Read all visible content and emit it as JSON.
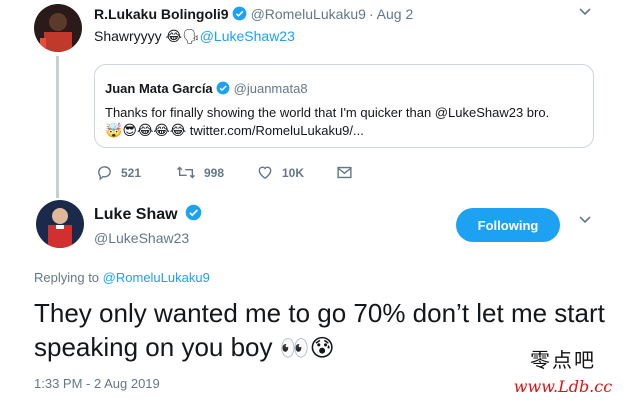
{
  "tweet1": {
    "name": "R.Lukaku Bolingoli9",
    "handle": "@RomeluLukaku9",
    "separator": "·",
    "date": "Aug 2",
    "text_start": "Shawryyyy",
    "text_emojis": "😂🗣",
    "mention": "@LukeShaw23",
    "actions": {
      "replies": "521",
      "retweets": "998",
      "likes": "10K"
    }
  },
  "quote": {
    "name": "Juan Mata García",
    "handle": "@juanmata8",
    "line1": "Thanks for finally showing the world that I'm quicker than @LukeShaw23 bro.",
    "line2_emojis": "🤯😎😂😂😂",
    "line2_link": "twitter.com/RomeluLukaku9/..."
  },
  "tweet2": {
    "name": "Luke Shaw",
    "handle": "@LukeShaw23",
    "follow_label": "Following",
    "replying_prefix": "Replying to",
    "replying_mention": "@RomeluLukaku9",
    "text": "They only wanted me to go 70% don’t let me start speaking on you boy",
    "text_emojis": "👀😰",
    "timestamp": "1:33 PM - 2 Aug 2019"
  },
  "watermark": {
    "chinese": "零点吧",
    "url": "www.Ldb.cc"
  },
  "colors": {
    "accent": "#1da1f2",
    "muted": "#657786",
    "text": "#14171a",
    "border": "#ccd6dd"
  },
  "icons": {
    "verified": "verified-badge-icon",
    "reply": "reply-icon",
    "retweet": "retweet-icon",
    "like": "heart-icon",
    "dm": "envelope-icon",
    "caret": "chevron-down-icon"
  }
}
